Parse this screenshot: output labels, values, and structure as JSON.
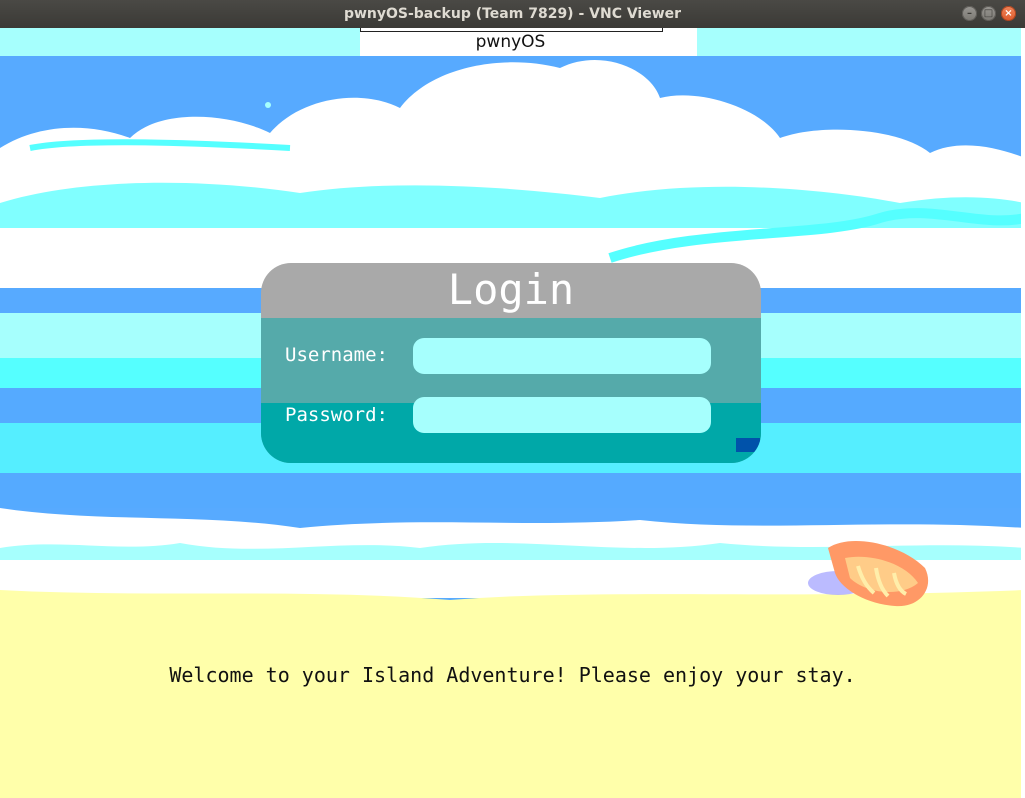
{
  "window": {
    "title": "pwnyOS-backup (Team 7829) - VNC Viewer",
    "controls": {
      "minimize": "–",
      "maximize": "□",
      "close": "×"
    }
  },
  "vnc": {
    "tab_label": "pwnyOS"
  },
  "login": {
    "title": "Login",
    "username_label": "Username:",
    "password_label": "Password:",
    "username_value": "",
    "password_value": ""
  },
  "welcome_text": "Welcome to your Island Adventure! Please enjoy your stay.",
  "colors": {
    "sky": "#57aaff",
    "cloud": "#ffffff",
    "water_light": "#a6fffd",
    "water_mid": "#55ffff",
    "sand": "#ffffaa",
    "login_header": "#a9a9a9",
    "login_body": "#55aaaa",
    "login_body_low": "#00a8a8"
  }
}
